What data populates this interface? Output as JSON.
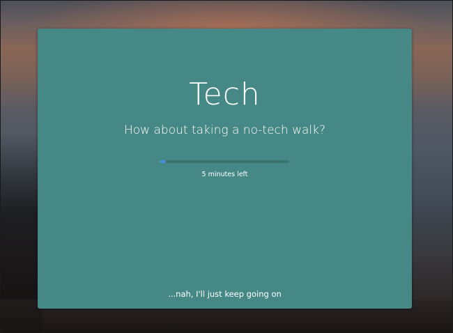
{
  "card": {
    "title": "Tech",
    "subtitle": "How about taking a no-tech walk?",
    "progress": {
      "fraction": 0.05,
      "fill_color": "#4a90d9",
      "track_color": "#3b7370"
    },
    "time_left": "5 minutes left",
    "dismiss_label": "...nah, I'll just keep going on",
    "background_color": "#468885"
  }
}
